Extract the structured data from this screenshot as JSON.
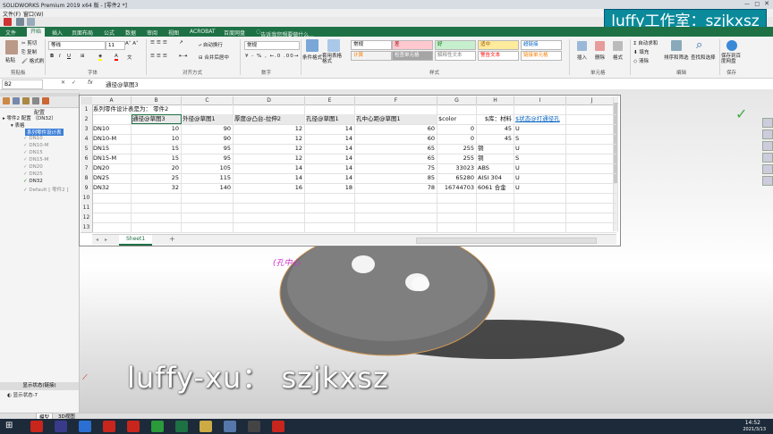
{
  "window": {
    "title": "SOLIDWORKS Premium 2019 x64 版 - [零件2 *]",
    "menu": [
      "文件(F)",
      "窗口(W)"
    ]
  },
  "banner": "luffy工作室：szjkxsz",
  "ribbon": {
    "tabs": [
      "文件",
      "开始",
      "插入",
      "页面布局",
      "公式",
      "数据",
      "审阅",
      "视图",
      "ACROBAT",
      "百度网盘"
    ],
    "active_tab": "开始",
    "tell_me": "告诉我您想要做什么...",
    "clipboard": {
      "paste": "粘贴",
      "cut": "剪切",
      "copy": "复制",
      "format_painter": "格式刷",
      "group": "剪贴板"
    },
    "font": {
      "name": "等线",
      "size": "11",
      "group": "字体"
    },
    "alignment": {
      "wrap": "自动换行",
      "merge": "合并后居中",
      "group": "对齐方式"
    },
    "number": {
      "format": "常规",
      "group": "数字"
    },
    "styles": {
      "conditional": "条件格式",
      "as_table": "套用表格格式",
      "cells": [
        {
          "label": "常规",
          "bg": "#ffffff",
          "fg": "#000000"
        },
        {
          "label": "差",
          "bg": "#ffc7ce",
          "fg": "#9c0006"
        },
        {
          "label": "好",
          "bg": "#c6efce",
          "fg": "#006100"
        },
        {
          "label": "适中",
          "bg": "#ffeb9c",
          "fg": "#9c5700"
        },
        {
          "label": "超链接",
          "bg": "#ffffff",
          "fg": "#0563c1"
        },
        {
          "label": "计算",
          "bg": "#f2f2f2",
          "fg": "#fa7d00"
        },
        {
          "label": "检查单元格",
          "bg": "#a5a5a5",
          "fg": "#ffffff"
        },
        {
          "label": "解释性文本",
          "bg": "#ffffff",
          "fg": "#7f7f7f"
        },
        {
          "label": "警告文本",
          "bg": "#ffffff",
          "fg": "#ff0000"
        },
        {
          "label": "链接单元格",
          "bg": "#ffffff",
          "fg": "#fa7d00"
        }
      ],
      "group": "样式"
    },
    "cells_group": {
      "insert": "插入",
      "delete": "删除",
      "format": "格式",
      "group": "单元格"
    },
    "editing": {
      "autosum": "自动求和",
      "fill": "填充",
      "clear": "清除",
      "sort": "排序和筛选",
      "find": "查找和选择",
      "group": "编辑"
    },
    "save": {
      "label": "保存到百度网盘",
      "group": "保存"
    }
  },
  "formula_bar": {
    "name_box": "B2",
    "fx": "fx",
    "content": "通径@草图3"
  },
  "sheet": {
    "columns": [
      "A",
      "B",
      "C",
      "D",
      "E",
      "F",
      "G",
      "H",
      "I",
      "J"
    ],
    "rows": [
      "1",
      "2",
      "3",
      "4",
      "5",
      "6",
      "7",
      "8",
      "9",
      "10",
      "11",
      "12",
      "13"
    ],
    "title": "系列零件设计表是为： 零件2",
    "headers": [
      "通径@草图3",
      "外径@草图1",
      "厚度@凸台-拉伸2",
      "孔径@草图1",
      "孔中心距@草图1",
      "$color",
      "$库：材料",
      "$状态@打通径孔"
    ],
    "data": [
      [
        "DN10",
        "10",
        "90",
        "12",
        "14",
        "60",
        "0",
        "45",
        "U"
      ],
      [
        "DN10-M",
        "10",
        "90",
        "12",
        "14",
        "60",
        "0",
        "45",
        "S"
      ],
      [
        "DN15",
        "15",
        "95",
        "12",
        "14",
        "65",
        "255",
        "铜",
        "U"
      ],
      [
        "DN15-M",
        "15",
        "95",
        "12",
        "14",
        "65",
        "255",
        "铜",
        "S"
      ],
      [
        "DN20",
        "20",
        "105",
        "14",
        "14",
        "75",
        "33023",
        "ABS",
        "U"
      ],
      [
        "DN25",
        "25",
        "115",
        "14",
        "14",
        "85",
        "65280",
        "AISI 304",
        "U"
      ],
      [
        "DN32",
        "32",
        "140",
        "16",
        "18",
        "78",
        "16744703",
        "6061 合金",
        "U"
      ]
    ],
    "tab": "Sheet1",
    "add_sheet": "+"
  },
  "left_panel": {
    "title": "配置",
    "root": "零件2 配置 （DN32）",
    "table": "表格",
    "selected": "系列零件设计表",
    "configs": [
      "DN10",
      "DN10-M",
      "DN15",
      "DN15-M",
      "DN20",
      "DN25",
      "DN32"
    ],
    "default": "Default [ 零件2 ]",
    "display_states": "显示状态(链接)",
    "display_state_item": "显示状态-7",
    "bottom_tabs": [
      "模型",
      "3D视图"
    ]
  },
  "viewport": {
    "annotation": "(孔中心",
    "watermark": "luffy-xu： szjkxsz"
  },
  "taskbar": {
    "time": "14:52",
    "date": "2021/3/13",
    "app_colors": [
      "#c8251c",
      "#3a3a8a",
      "#2a6fd1",
      "#c8251c",
      "#c8251c",
      "#2a9a3a",
      "#1e7145",
      "#ccaa44",
      "#5577aa",
      "#444444",
      "#c8251c"
    ]
  },
  "colors": {
    "excel_green": "#1e7145",
    "banner_bg": "#0a8a9a",
    "hyperlink": "#0563c1"
  }
}
